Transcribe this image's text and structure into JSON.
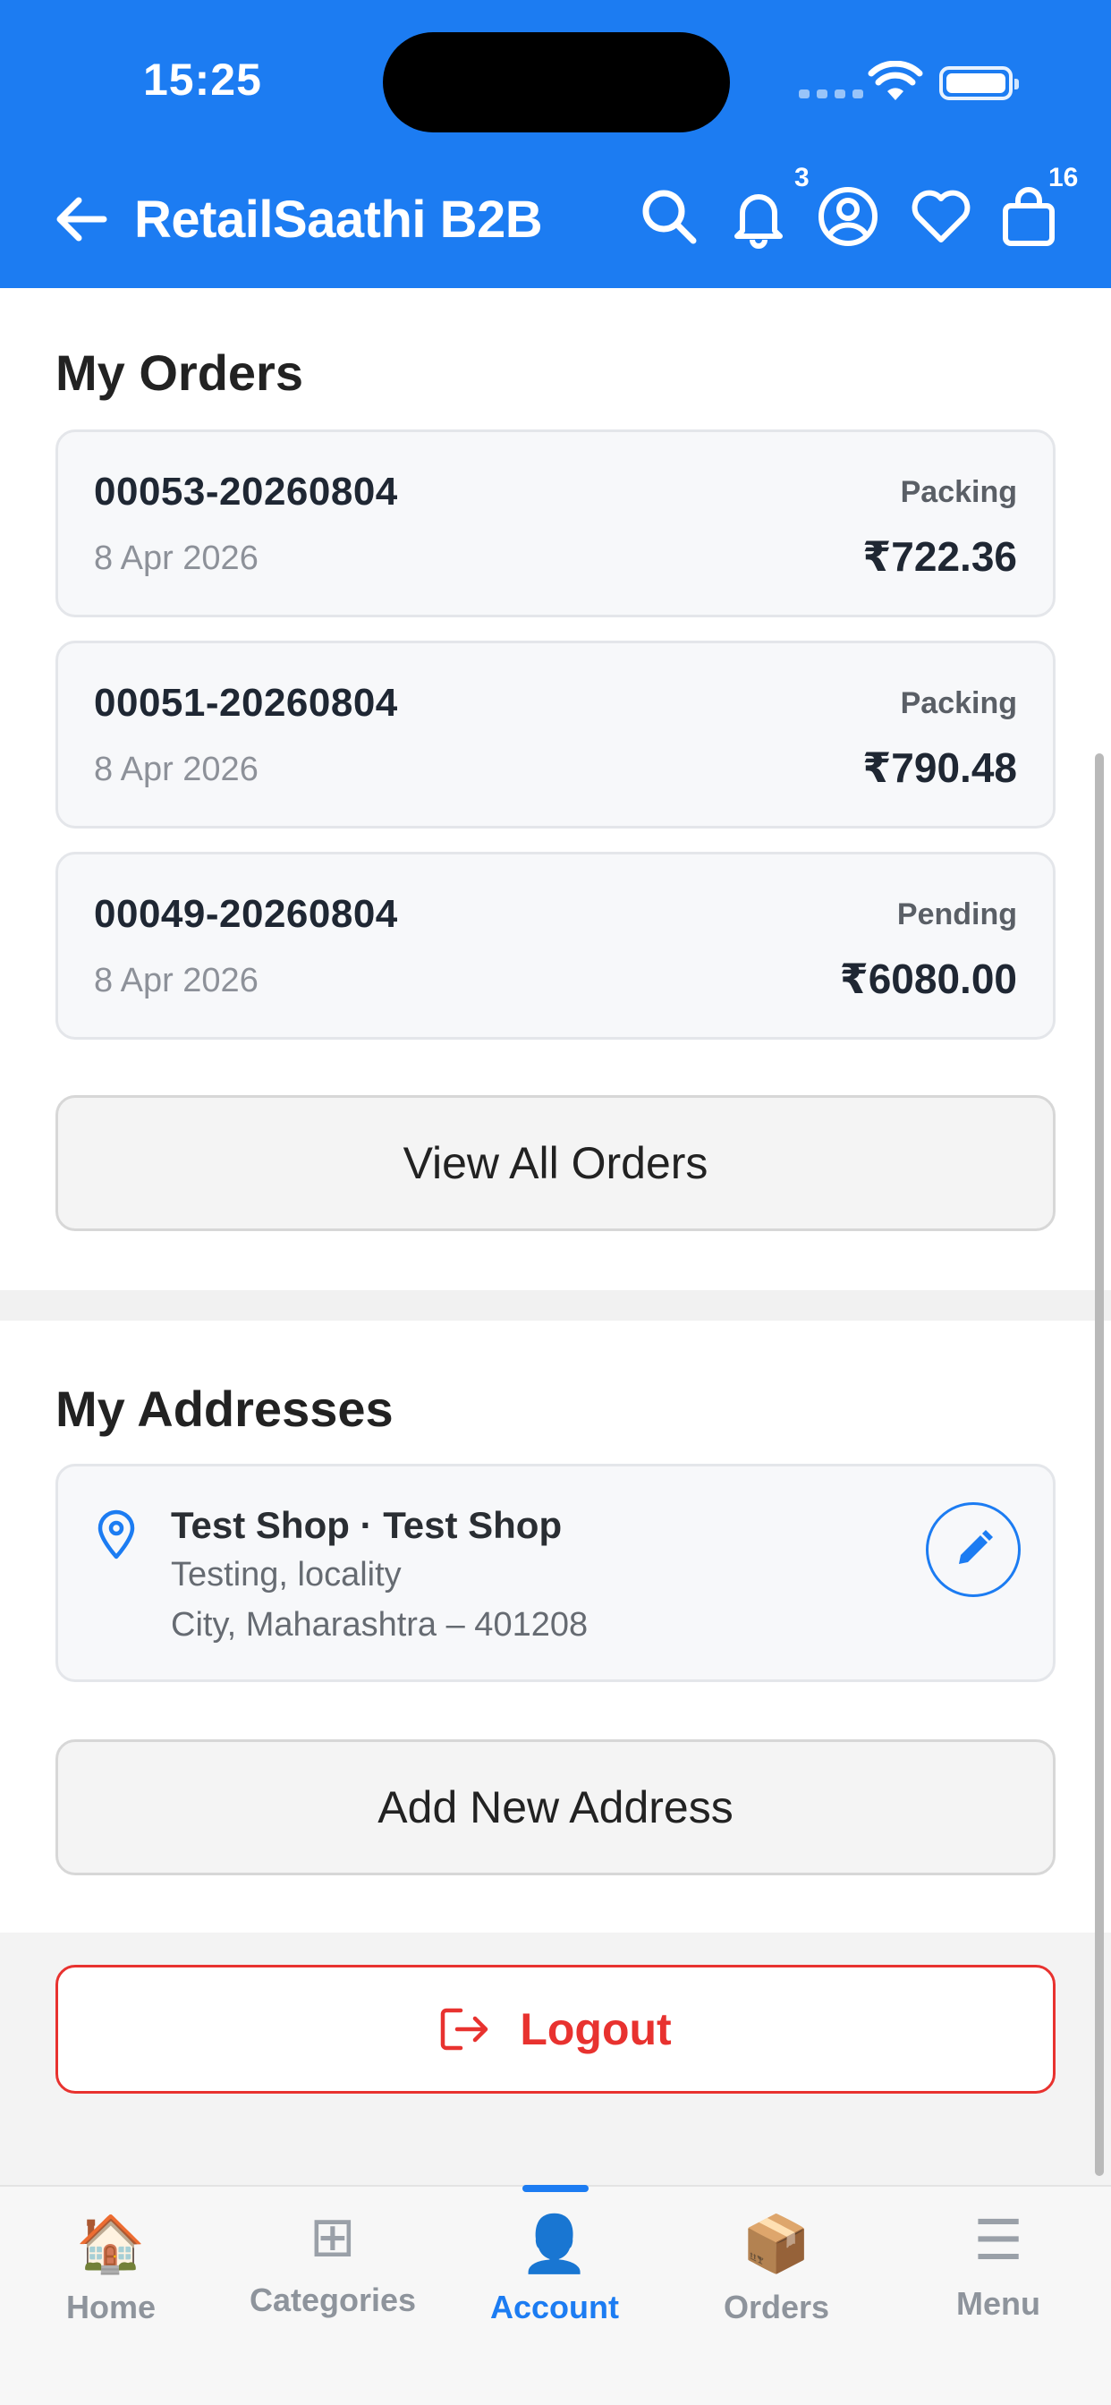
{
  "status_bar": {
    "time": "15:25"
  },
  "header": {
    "title": "RetailSaathi B2B",
    "notification_count": "3",
    "cart_count": "16"
  },
  "orders": {
    "title": "My Orders",
    "items": [
      {
        "id": "00053-20260804",
        "date": "8 Apr 2026",
        "status": "Packing",
        "amount": "₹722.36"
      },
      {
        "id": "00051-20260804",
        "date": "8 Apr 2026",
        "status": "Packing",
        "amount": "₹790.48"
      },
      {
        "id": "00049-20260804",
        "date": "8 Apr 2026",
        "status": "Pending",
        "amount": "₹6080.00"
      }
    ],
    "view_all_label": "View All Orders"
  },
  "addresses": {
    "title": "My Addresses",
    "items": [
      {
        "name": "Test Shop · Test Shop",
        "line1": "Testing, locality",
        "line2": "City, Maharashtra – 401208"
      }
    ],
    "add_label": "Add New Address"
  },
  "logout_label": "Logout",
  "bottom_nav": {
    "items": [
      {
        "label": "Home",
        "icon": "🏠"
      },
      {
        "label": "Categories",
        "icon": "⊞"
      },
      {
        "label": "Account",
        "icon": "👤"
      },
      {
        "label": "Orders",
        "icon": "📦"
      },
      {
        "label": "Menu",
        "icon": "☰"
      }
    ],
    "active": "Account"
  },
  "colors": {
    "primary": "#1c7cf2",
    "danger": "#e8322f"
  }
}
